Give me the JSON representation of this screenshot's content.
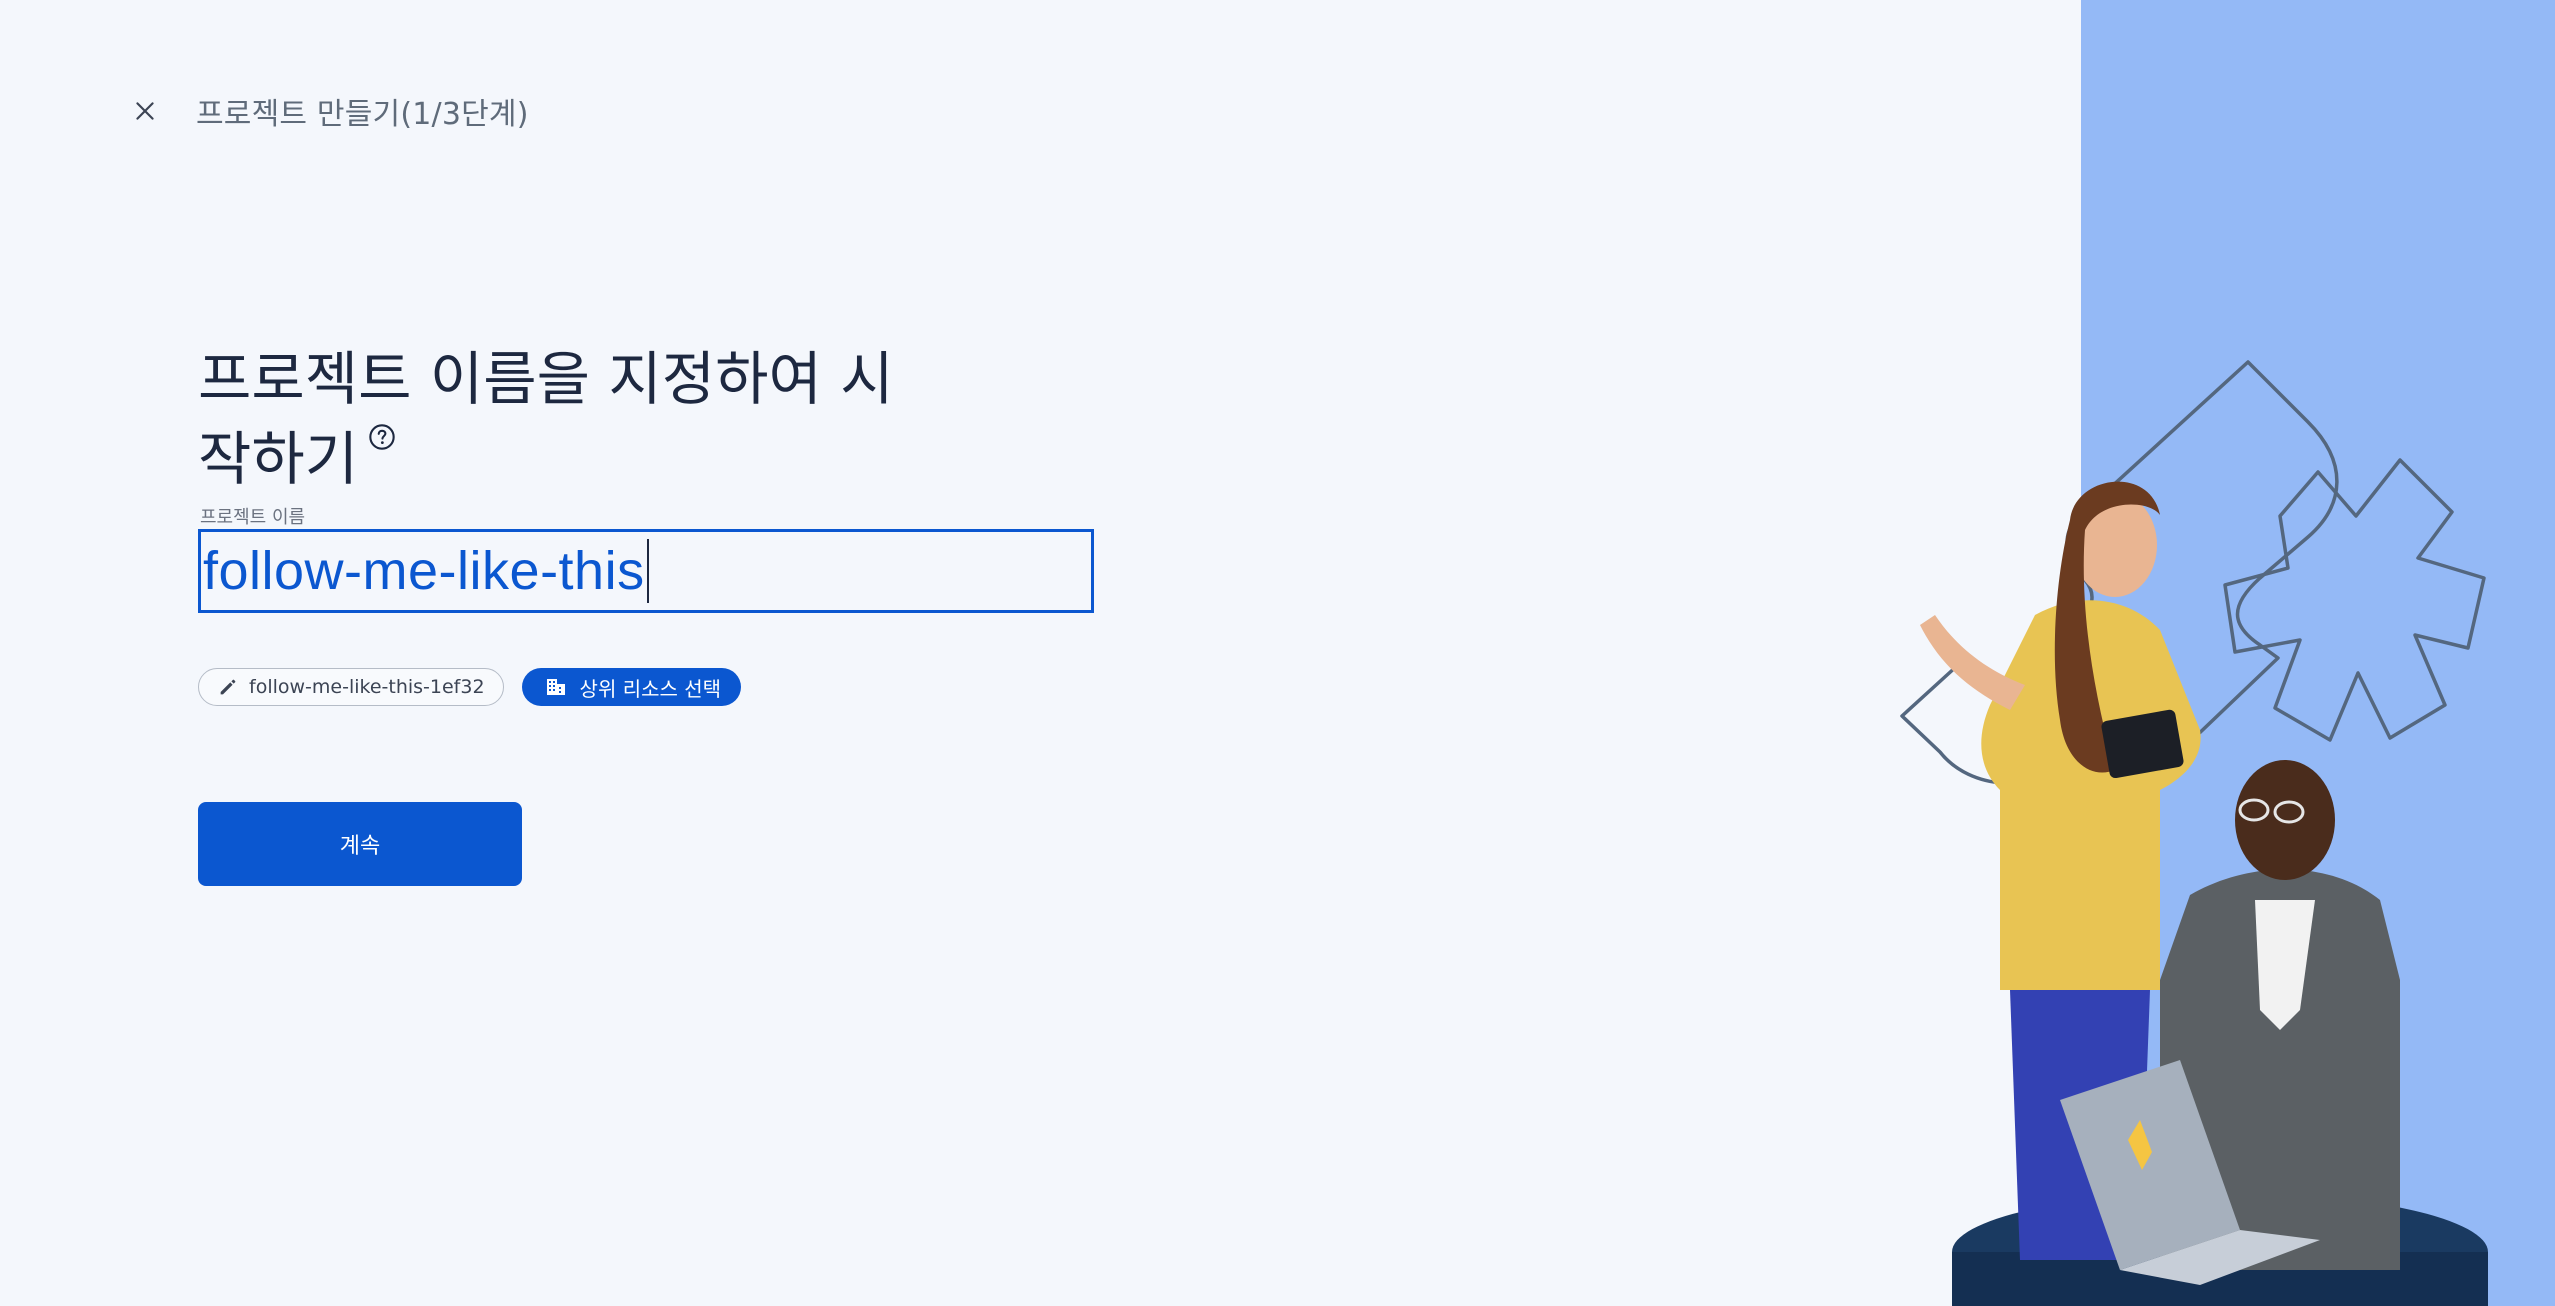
{
  "header": {
    "close_icon": "close-icon",
    "step_title": "프로젝트 만들기(1/3단계)"
  },
  "main": {
    "headline_line1": "프로젝트 이름을 지정하여 시",
    "headline_line2": "작하기",
    "help_icon": "help-circle-icon",
    "project_name_label": "프로젝트 이름",
    "project_name_value": "follow-me-like-this",
    "project_id_chip": "follow-me-like-this-1ef32",
    "project_id_chip_icon": "pencil-icon",
    "parent_resource_chip": "상위 리소스 선택",
    "parent_resource_chip_icon": "building-icon",
    "continue_button": "계속"
  },
  "colors": {
    "accent": "#0b57d0",
    "background": "#f4f7fc",
    "side_panel": "#94b9f6",
    "headline": "#1d2840"
  }
}
